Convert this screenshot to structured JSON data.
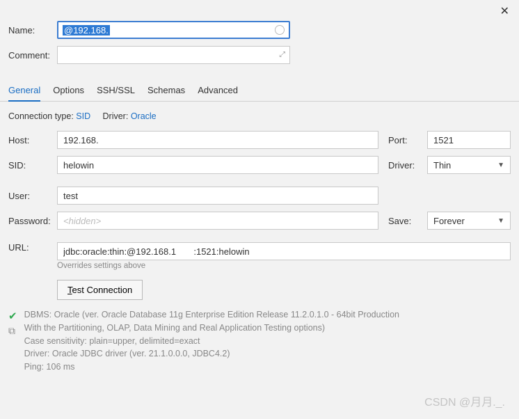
{
  "close_label": "✕",
  "name": {
    "label": "Name:",
    "value": "@192.168.      ",
    "highlighted": true
  },
  "comment": {
    "label": "Comment:",
    "value": ""
  },
  "tabs": [
    "General",
    "Options",
    "SSH/SSL",
    "Schemas",
    "Advanced"
  ],
  "active_tab": 0,
  "connection_line": {
    "type_label": "Connection type:",
    "type_value": "SID",
    "driver_label": "Driver:",
    "driver_value": "Oracle"
  },
  "host": {
    "label": "Host:",
    "value": "192.168."
  },
  "port": {
    "label": "Port:",
    "value": "1521"
  },
  "sid": {
    "label": "SID:",
    "value": "helowin"
  },
  "driver": {
    "label": "Driver:",
    "value": "Thin"
  },
  "user": {
    "label": "User:",
    "value": "test"
  },
  "password": {
    "label": "Password:",
    "placeholder": "<hidden>",
    "value": ""
  },
  "save": {
    "label": "Save:",
    "value": "Forever"
  },
  "url": {
    "label": "URL:",
    "value": "jdbc:oracle:thin:@192.168.1       :1521:helowin",
    "hint": "Overrides settings above"
  },
  "test_button": "Test Connection",
  "result": {
    "line1": "DBMS: Oracle (ver. Oracle Database 11g Enterprise Edition Release 11.2.0.1.0 - 64bit Production",
    "line2": "With the Partitioning, OLAP, Data Mining and Real Application Testing options)",
    "line3": "Case sensitivity: plain=upper, delimited=exact",
    "line4": "Driver: Oracle JDBC driver (ver. 21.1.0.0.0, JDBC4.2)",
    "line5": "Ping: 106 ms"
  },
  "watermark": "CSDN @月月._."
}
